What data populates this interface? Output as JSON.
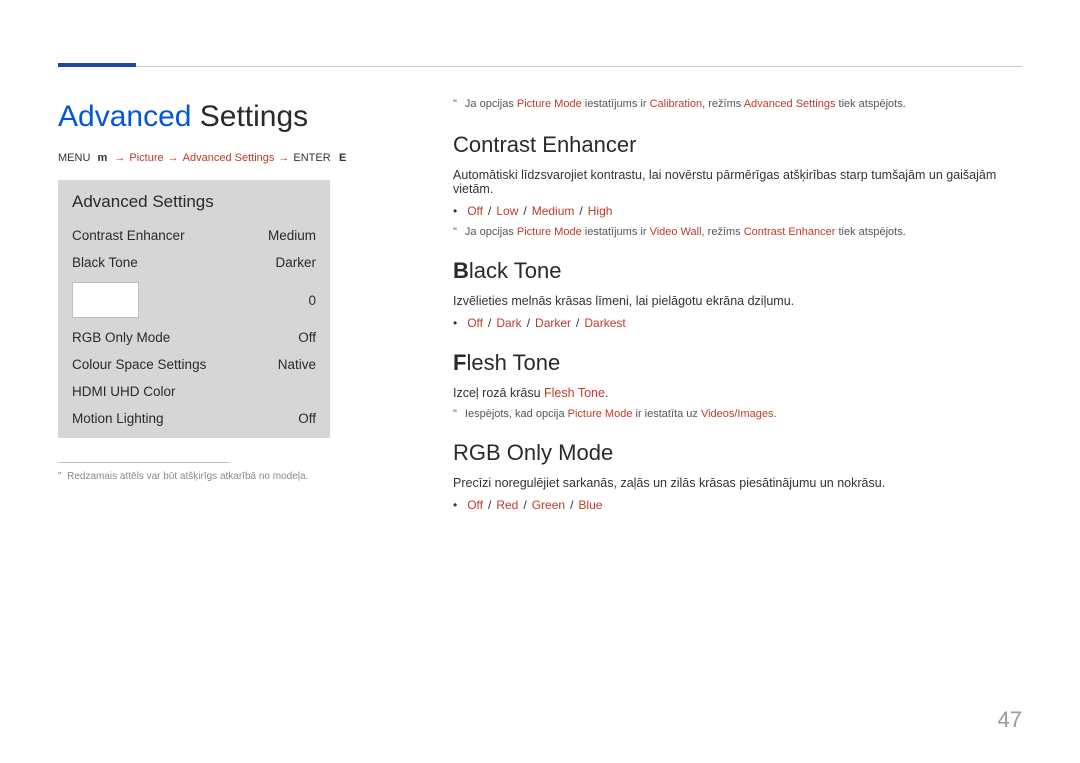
{
  "page": {
    "title_accent": "Advanced",
    "title_rest": " Settings",
    "page_number": "47"
  },
  "breadcrumb": {
    "menu": "MENU",
    "menu_icon": "m",
    "picture": "Picture",
    "advanced": "Advanced Settings",
    "enter": "ENTER",
    "enter_icon": "E",
    "arrow": "→"
  },
  "panel": {
    "header": "Advanced Settings",
    "rows": [
      {
        "label": "Contrast Enhancer",
        "value": "Medium"
      },
      {
        "label": "Black Tone",
        "value": "Darker"
      },
      {
        "label": "",
        "value": "0",
        "placeholder": true
      },
      {
        "label": "RGB Only Mode",
        "value": "Off"
      },
      {
        "label": "Colour Space Settings",
        "value": "Native"
      },
      {
        "label": "HDMI UHD Color",
        "value": ""
      },
      {
        "label": "Motion Lighting",
        "value": "Off"
      }
    ]
  },
  "footnote_panel": "Redzamais attēls var būt atšķirīgs atkarībā no modeļa.",
  "topnote": {
    "prefix": "Ja opcijas ",
    "pm": "Picture Mode",
    "mid": " iestatījums ir ",
    "cal": "Calibration",
    "mid2": ", režīms ",
    "as": "Advanced Settings",
    "suffix": " tiek atspējots."
  },
  "sections": {
    "contrast": {
      "h_prefix": "Contrast E",
      "h_rest": "nhancer",
      "body": "Automātiski līdzsvarojiet kontrastu, lai novērstu pārmērīgas atšķirības starp tumšajām un gaišajām vietām.",
      "opts": [
        "Off",
        "Low",
        "Medium",
        "High"
      ],
      "note_prefix": "Ja opcijas ",
      "note_pm": "Picture Mode",
      "note_mid": " iestatījums ir ",
      "note_vw": "Video Wall",
      "note_mid2": ", režīms ",
      "note_ce": "Contrast Enhancer",
      "note_suffix": " tiek atspējots."
    },
    "blacktone": {
      "h_prefix": "B",
      "h_rest": "lack Tone",
      "body": "Izvēlieties melnās krāsas līmeni, lai pielāgotu ekrāna dziļumu.",
      "opts": [
        "Off",
        "Dark",
        "Darker",
        "Darkest"
      ]
    },
    "fleshtone": {
      "h_prefix": "F",
      "h_rest": "lesh Tone",
      "body_prefix": "Izceļ rozā krāsu ",
      "body_ft": "Flesh Tone",
      "body_suffix": ".",
      "note_prefix": "Iespējots, kad opcija ",
      "note_pm": "Picture Mode",
      "note_mid": " ir iestatīta uz ",
      "note_vi": "Videos/Images",
      "note_suffix": "."
    },
    "rgb": {
      "h_prefix": "RGB O",
      "h_rest": "nly Mode",
      "body": "Precīzi noregulējiet sarkanās, zaļās un zilās krāsas piesātinājumu un nokrāsu.",
      "opts": [
        "Off",
        "Red",
        "Green",
        "Blue"
      ]
    }
  }
}
